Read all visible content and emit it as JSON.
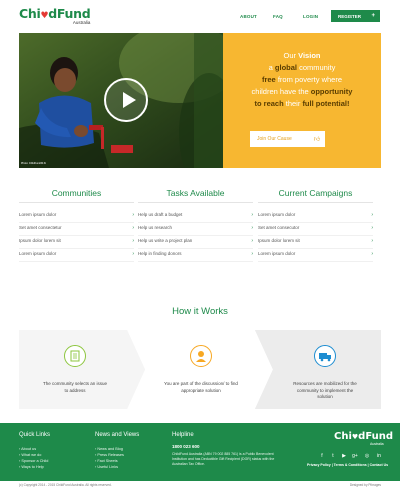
{
  "header": {
    "logo_text_a": "Chi",
    "logo_text_b": "dFund",
    "logo_sub": "Australia",
    "nav": [
      "ABOUT",
      "FAQ",
      "LOGIN"
    ],
    "register_label": "REGISTER",
    "register_icon": "plus-icon"
  },
  "hero": {
    "photo_credit": "Photo: ChildFund/M.Ki",
    "vision_p1": "Our ",
    "vision_p2": "Vision",
    "vision_p3": "a ",
    "vision_p4": "global",
    "vision_p5": " community",
    "vision_p6": "free",
    "vision_p7": " from poverty where",
    "vision_p8": "children have the ",
    "vision_p9": "opportunity",
    "vision_p10": "to reach",
    "vision_p11": " their ",
    "vision_p12": "full potential!",
    "join_label": "Join Our Cause",
    "colors": {
      "panel": "#f7b731",
      "brand": "#1e8a4a"
    }
  },
  "columns": [
    {
      "title": "Communities",
      "items": [
        "Lorem ipsum dolor",
        "Set amet consectetur",
        "Ipsum dolor lorem sit",
        "Lorem ipsum dolor"
      ]
    },
    {
      "title": "Tasks Available",
      "items": [
        "Help us draft a budget",
        "Help us research",
        "Help us write a project plan",
        "Help in finding donors"
      ]
    },
    {
      "title": "Current Campaigns",
      "items": [
        "Lorem ipsum dolor",
        "Set amet consecutor",
        "Ipsum dolor lorem sit",
        "Lorem ipsum dolor"
      ]
    }
  ],
  "how": {
    "title": "How it Works",
    "steps": [
      {
        "icon": "checklist-icon",
        "text": "The community selects an issue to address",
        "color": "#8dc63f"
      },
      {
        "icon": "person-icon",
        "text": "You are part of the discussion/ to find appropriate solution",
        "color": "#f7a823"
      },
      {
        "icon": "truck-icon",
        "text": "Resources are mobilized for the community to implement the solution",
        "color": "#1d8dd1"
      }
    ]
  },
  "footer": {
    "quick_links_title": "Quick Links",
    "quick_links": [
      "About us",
      "What we do",
      "Sponsor a Child",
      "Ways to Help"
    ],
    "news_title": "News and Views",
    "news_links": [
      "News and Blog",
      "Press Releases",
      "Fact Sheets",
      "Useful Links"
    ],
    "helpline_title": "Helpline",
    "phone": "1800 023 600",
    "desc": "ChildFund Australia (ABN 79 002 885 761) is a Public Benevolent Institution and has Deductible Gift Recipient (DGR) status with the Australian Tax Office.",
    "logo_a": "Chi",
    "logo_b": "dFund",
    "logo_sub": "Australia",
    "socials": [
      "f",
      "t",
      "▶",
      "g+",
      "◎",
      "in"
    ],
    "policy_links": "Privacy Policy  |  Terms & Conditions  |  Contact Us",
    "copyright": "(c) Copyright 2014 - 2015 ChildFund Australia. All rights reserved.",
    "designed_by": "Designed by Pibrages"
  }
}
